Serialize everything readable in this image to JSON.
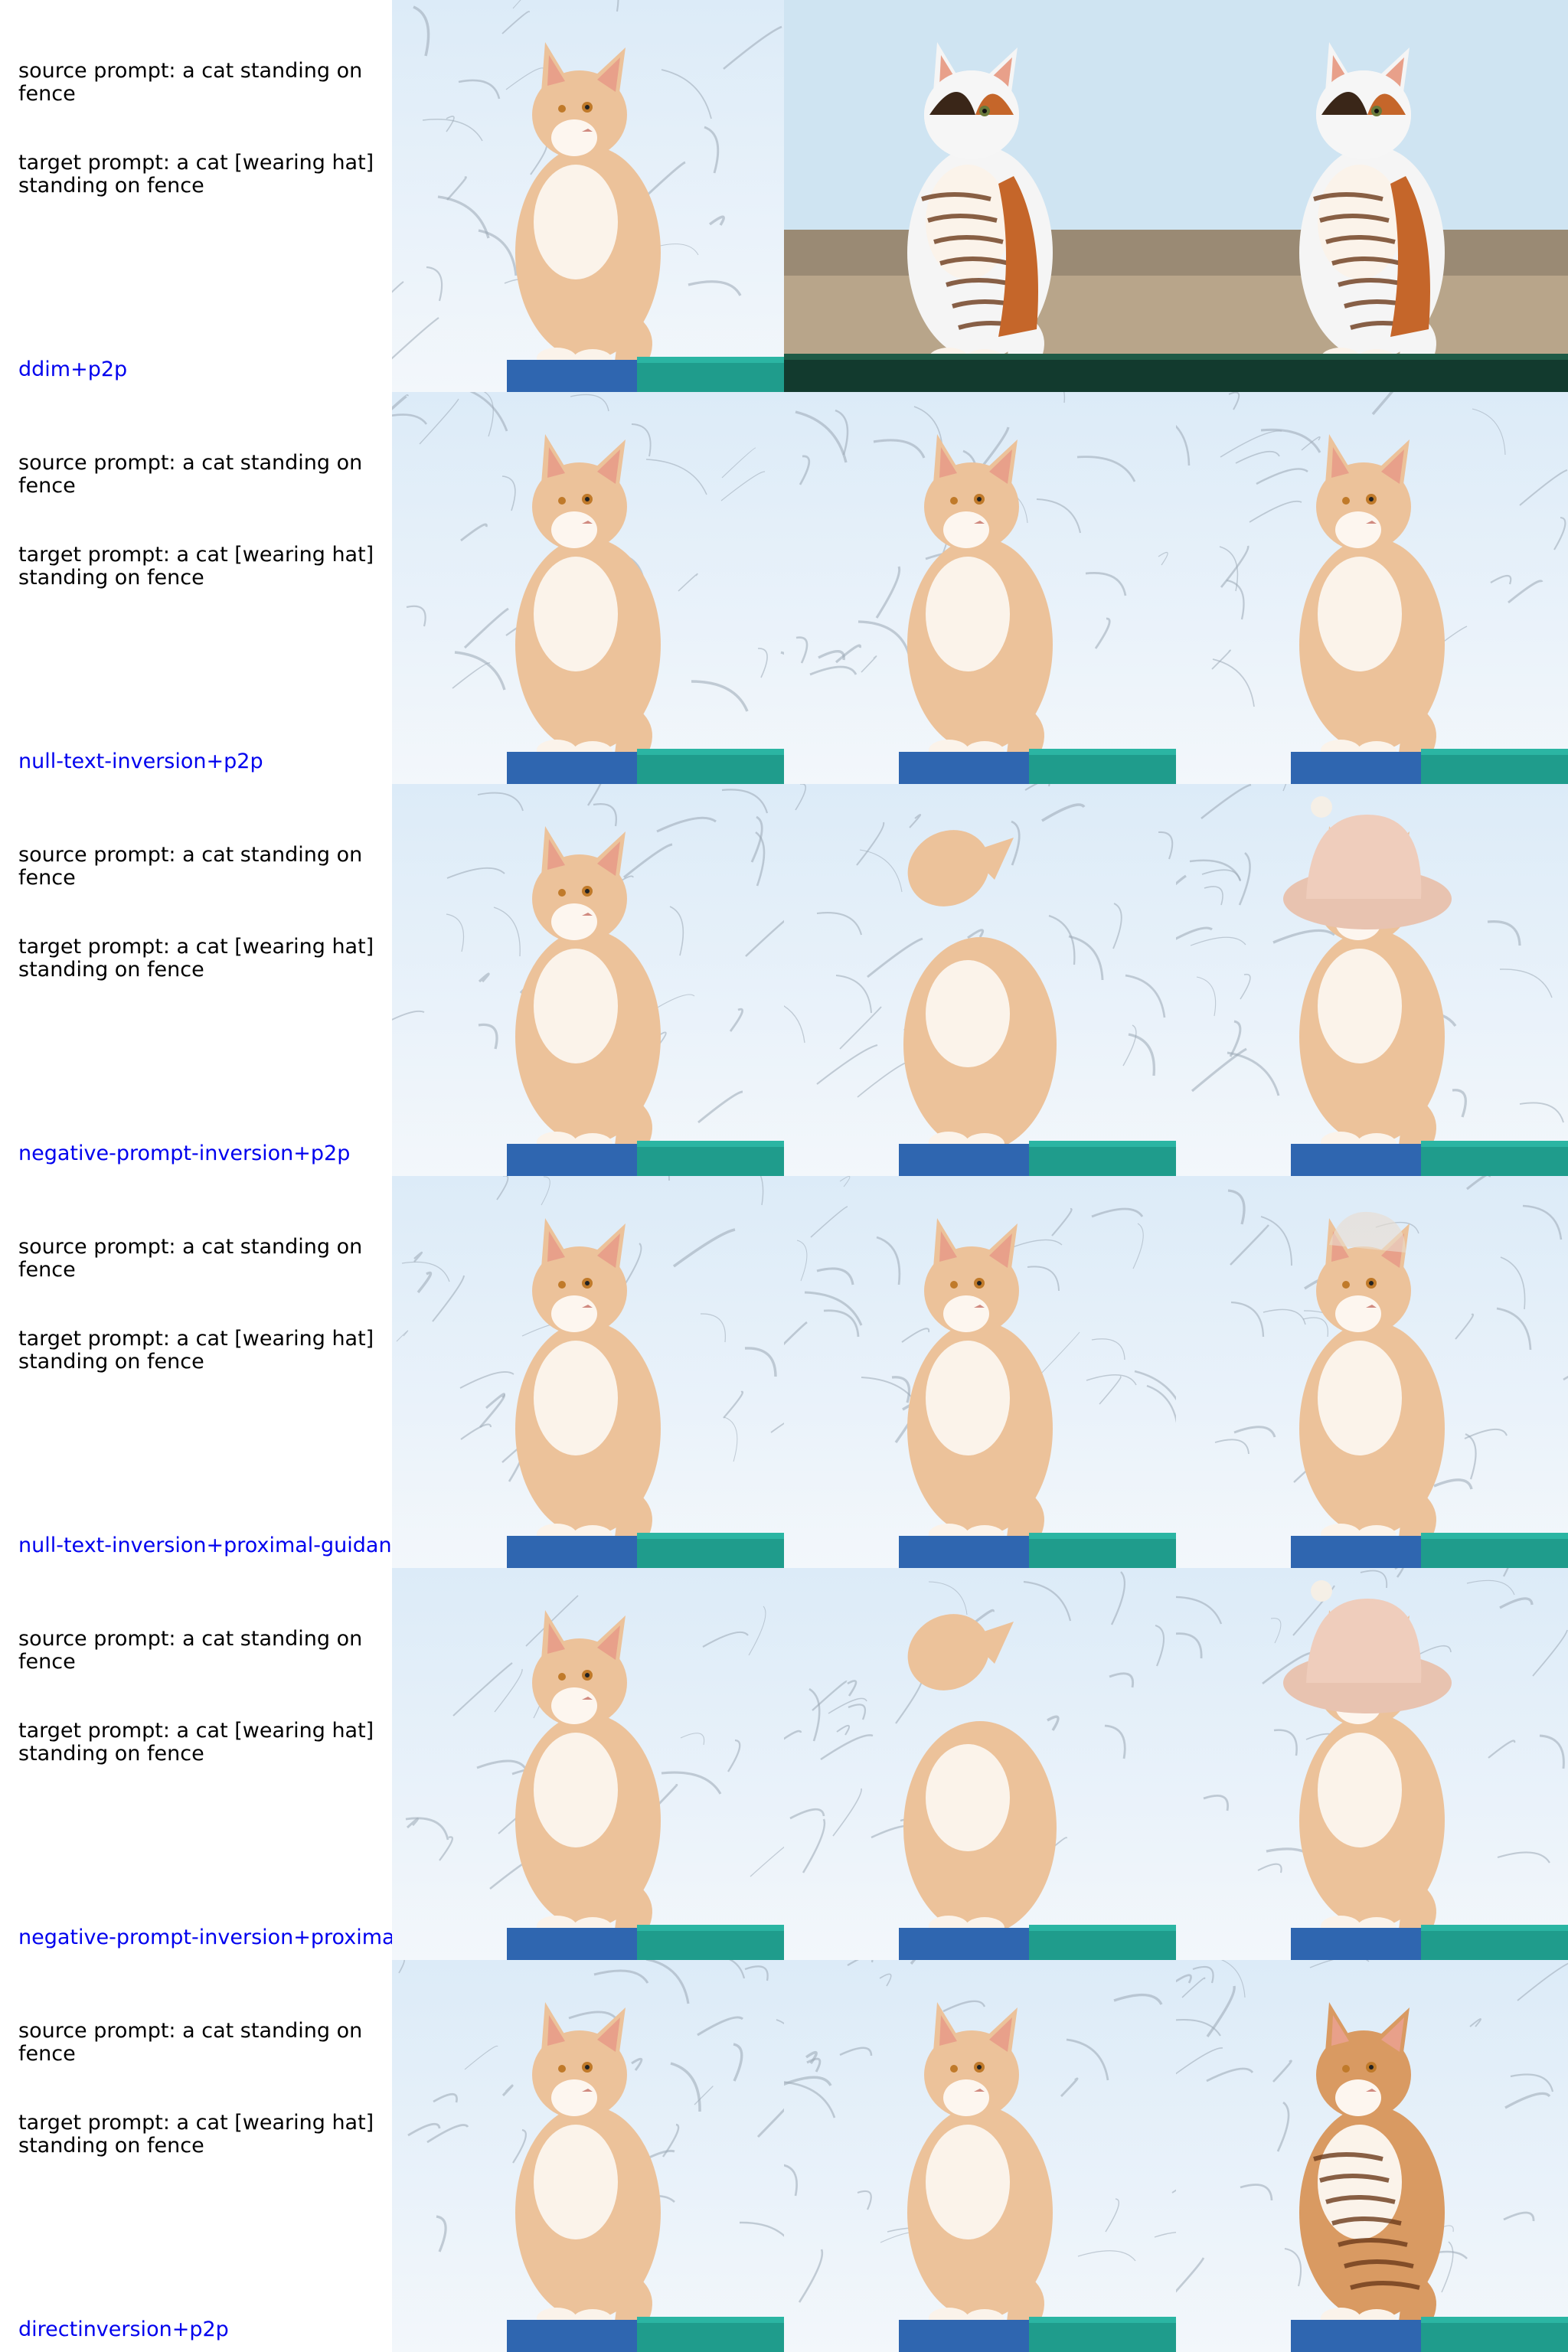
{
  "rows": [
    {
      "source_prompt": "source prompt: a cat standing on fence",
      "target_prompt": "target prompt: a cat [wearing hat] standing on fence",
      "method": "ddim+p2p",
      "images": [
        {
          "subject": "ginger cat on fence, snowy branches",
          "variant": "source",
          "hat": false
        },
        {
          "subject": "calico cat on dark green fence, landscape",
          "variant": "calico",
          "hat": false
        },
        {
          "subject": "calico cat on dark green fence, landscape",
          "variant": "calico",
          "hat": false
        }
      ]
    },
    {
      "source_prompt": "source prompt: a cat standing on fence",
      "target_prompt": "target prompt: a cat [wearing hat] standing on fence",
      "method": "null-text-inversion+p2p",
      "images": [
        {
          "subject": "ginger cat on fence, snowy branches",
          "variant": "source",
          "hat": false
        },
        {
          "subject": "ginger cat on fence, snowy branches",
          "variant": "source",
          "hat": false
        },
        {
          "subject": "ginger cat on fence, snowy branches",
          "variant": "source",
          "hat": false
        }
      ]
    },
    {
      "source_prompt": "source prompt: a cat standing on fence",
      "target_prompt": "target prompt: a cat [wearing hat] standing on fence",
      "method": "negative-prompt-inversion+p2p",
      "images": [
        {
          "subject": "ginger cat on fence, snowy branches",
          "variant": "source",
          "hat": false
        },
        {
          "subject": "cat looking upward, blurred snowy background",
          "variant": "upward",
          "hat": false
        },
        {
          "subject": "cat with large beige hat over head",
          "variant": "hat",
          "hat": true
        }
      ]
    },
    {
      "source_prompt": "source prompt: a cat standing on fence",
      "target_prompt": "target prompt: a cat [wearing hat] standing on fence",
      "method": "null-text-inversion+proximal-guidance",
      "images": [
        {
          "subject": "ginger cat on fence, snowy branches",
          "variant": "source",
          "hat": false
        },
        {
          "subject": "ginger cat on fence, snowy branches",
          "variant": "source",
          "hat": false
        },
        {
          "subject": "ginger cat with faint hat, snowy branches",
          "variant": "faint-hat",
          "hat": true
        }
      ]
    },
    {
      "source_prompt": "source prompt: a cat standing on fence",
      "target_prompt": "target prompt: a cat [wearing hat] standing on fence",
      "method": "negative-prompt-inversion+proximal-g",
      "images": [
        {
          "subject": "ginger cat on fence, snowy branches",
          "variant": "source",
          "hat": false
        },
        {
          "subject": "cat looking upward, blurred snowy background",
          "variant": "upward",
          "hat": false
        },
        {
          "subject": "cat with large beige hat over head",
          "variant": "hat",
          "hat": true
        }
      ]
    },
    {
      "source_prompt": "source prompt: a cat standing on fence",
      "target_prompt": "target prompt: a cat [wearing hat] standing on fence",
      "method": "directinversion+p2p",
      "images": [
        {
          "subject": "ginger cat on fence, snowy branches",
          "variant": "source",
          "hat": false
        },
        {
          "subject": "ginger cat on fence, snowy branches",
          "variant": "source",
          "hat": false
        },
        {
          "subject": "striped tabby cat on blue fence, snowy branches",
          "variant": "tabby",
          "hat": false
        }
      ]
    }
  ],
  "colors": {
    "method_label": "#0000ee",
    "prompt_text": "#000000",
    "sky": "#e6f1fa",
    "fur": "#e9b88a",
    "fence_blue": "#2f66b0",
    "fence_teal": "#1f9c8c"
  }
}
